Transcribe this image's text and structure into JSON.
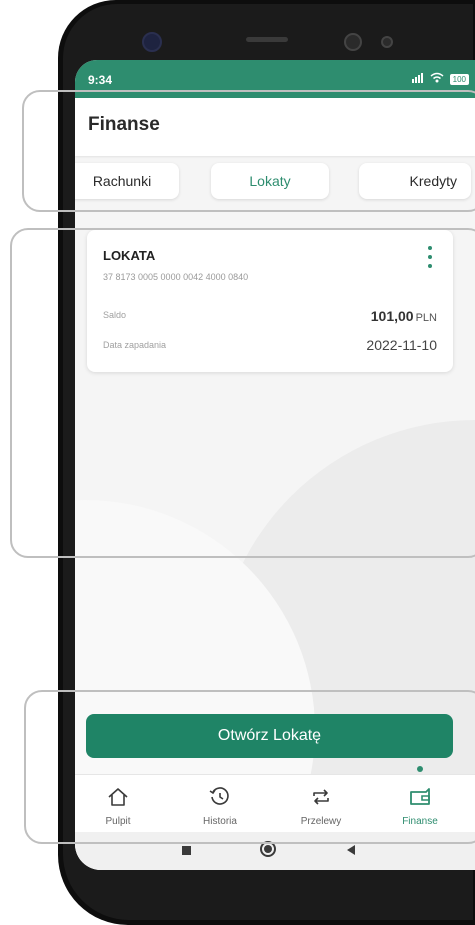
{
  "status_bar": {
    "time": "9:34",
    "signal": "R.ıl",
    "wifi": "wifi",
    "battery": "100"
  },
  "header": {
    "title": "Finanse"
  },
  "tabs": [
    {
      "label": "Rachunki",
      "active": false
    },
    {
      "label": "Lokaty",
      "active": true
    },
    {
      "label": "Kredyty",
      "active": false
    }
  ],
  "deposit_card": {
    "title": "LOKATA",
    "account_number": "37 8173 0005 0000 0042 4000 0840",
    "balance_label": "Saldo",
    "balance_amount": "101,00",
    "balance_currency": "PLN",
    "maturity_label": "Data zapadania",
    "maturity_date": "2022-11-10",
    "menu_icon": "more-vertical-icon"
  },
  "cta": {
    "label": "Otwórz Lokatę"
  },
  "bottom_nav": {
    "items": [
      {
        "label": "Pulpit",
        "icon": "home-icon",
        "active": false
      },
      {
        "label": "Historia",
        "icon": "history-icon",
        "active": false
      },
      {
        "label": "Przelewy",
        "icon": "transfer-icon",
        "active": false
      },
      {
        "label": "Finanse",
        "icon": "wallet-icon",
        "active": true
      }
    ]
  },
  "colors": {
    "accent": "#2e8d6f",
    "cta_bg": "#1f8466",
    "phone_body": "#0d0d0d"
  }
}
